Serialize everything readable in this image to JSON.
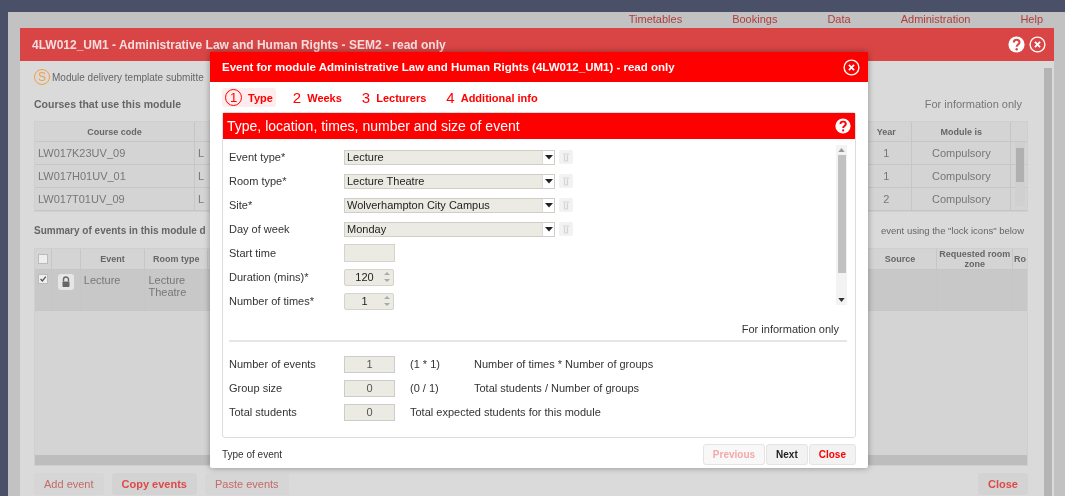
{
  "top_menu": [
    "Timetables",
    "Bookings",
    "Data",
    "Administration",
    "Help"
  ],
  "window": {
    "title": "4LW012_UM1 - Administrative Law and Human Rights - SEM2 - read only",
    "notice": {
      "badge": "S",
      "text": "Module delivery template submitte"
    },
    "courses": {
      "heading": "Courses that use this module",
      "info": "For information only",
      "headers": {
        "course_code": "Course code",
        "year": "Year",
        "module_is": "Module is"
      },
      "rows": [
        {
          "course_code": "LW017K23UV_09",
          "column_2": "L",
          "year": "1",
          "module_is": "Compulsory"
        },
        {
          "course_code": "LW017H01UV_01",
          "column_2": "L",
          "year": "1",
          "module_is": "Compulsory"
        },
        {
          "course_code": "LW017T01UV_09",
          "column_2": "L",
          "year": "2",
          "module_is": "Compulsory"
        }
      ]
    },
    "events": {
      "heading": "Summary of events in this module d",
      "hint": "event using the \"lock icons\" below",
      "all_checked": false,
      "headers": {
        "event": "Event",
        "room_type": "Room type",
        "source": "Source",
        "requested_room_zone": "Requested room zone",
        "column_7": "Ro"
      },
      "rows": [
        {
          "selected": true,
          "locked": true,
          "event": "Lecture",
          "room_type": "Lecture Theatre"
        }
      ]
    },
    "buttons": [
      {
        "label": "Add event",
        "disabled": true
      },
      {
        "label": "Copy events",
        "disabled": false
      },
      {
        "label": "Paste events",
        "disabled": true
      }
    ],
    "close_button": "Close"
  },
  "dialog": {
    "title": "Event for module Administrative Law and Human Rights (4LW012_UM1) - read only",
    "steps": [
      {
        "number": "1",
        "label": "Type",
        "selected": true
      },
      {
        "number": "2",
        "label": "Weeks",
        "selected": false
      },
      {
        "number": "3",
        "label": "Lecturers",
        "selected": false
      },
      {
        "number": "4",
        "label": "Additional info",
        "selected": false
      }
    ],
    "panel_title": "Type, location, times, number and size of event",
    "fields": [
      {
        "kind": "select",
        "label": "Event type*",
        "value": "Lecture"
      },
      {
        "kind": "select",
        "label": "Room type*",
        "value": "Lecture Theatre"
      },
      {
        "kind": "select",
        "label": "Site*",
        "value": "Wolverhampton City Campus"
      },
      {
        "kind": "select",
        "label": "Day of week",
        "value": "Monday"
      },
      {
        "kind": "text",
        "label": "Start time"
      },
      {
        "kind": "number",
        "label": "Duration (mins)*",
        "value": "120"
      },
      {
        "kind": "number",
        "label": "Number of times*",
        "value": "1"
      }
    ],
    "info": "For information only",
    "summary": [
      {
        "label": "Number of events",
        "value": "1",
        "formula": "(1 * 1)",
        "description": "Number of times * Number of groups"
      },
      {
        "label": "Group size",
        "value": "0",
        "formula": "(0 / 1)",
        "description": "Total students / Number of groups"
      },
      {
        "label": "Total students",
        "value": "0",
        "description": "Total expected students for this module"
      }
    ],
    "footer_hint": "Type of event",
    "buttons": [
      {
        "kind": "nav",
        "label": "Previous",
        "disabled": true
      },
      {
        "kind": "nav",
        "label": "Next",
        "disabled": false
      },
      {
        "kind": "close",
        "label": "Close",
        "disabled": false
      }
    ]
  }
}
